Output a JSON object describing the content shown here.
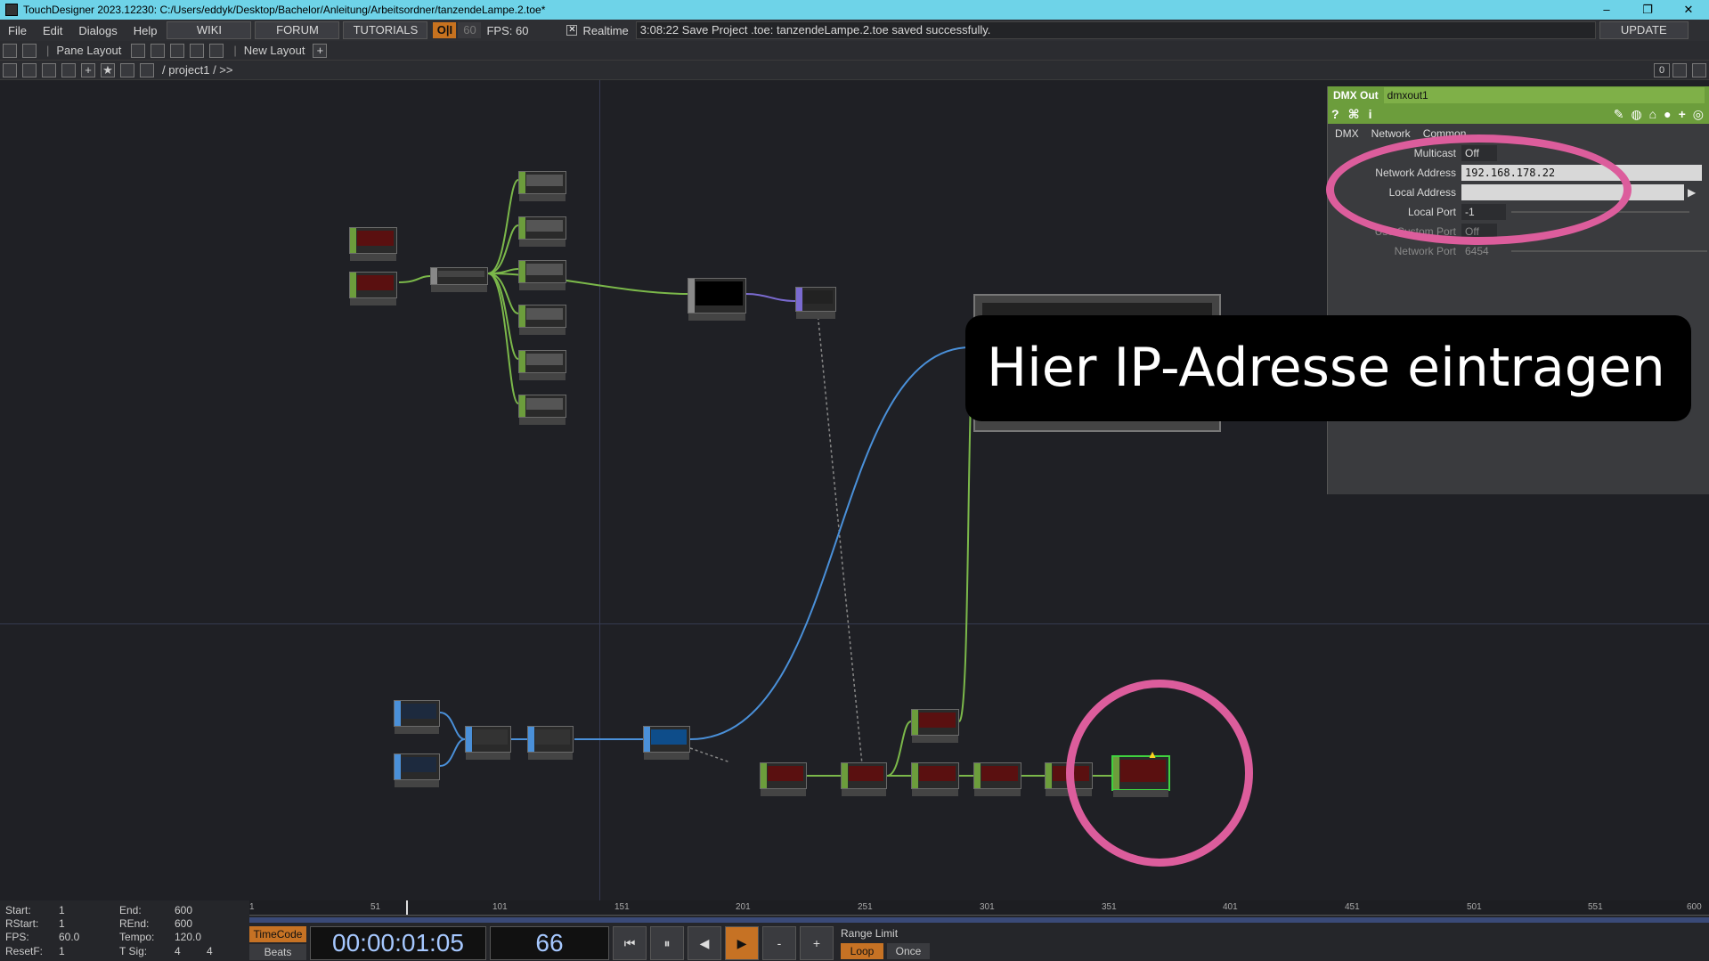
{
  "window": {
    "title": "TouchDesigner 2023.12230: C:/Users/eddyk/Desktop/Bachelor/Anleitung/Arbeitsordner/tanzendeLampe.2.toe*",
    "minimize": "–",
    "maximize": "❐",
    "close": "✕"
  },
  "menu": {
    "items": [
      "File",
      "Edit",
      "Dialogs",
      "Help"
    ],
    "wiki": "WIKI",
    "forum": "FORUM",
    "tutorials": "TUTORIALS",
    "perform": "O|I",
    "sixty": "60",
    "fps": "FPS:   60",
    "realtime": "Realtime",
    "status": "3:08:22 Save Project .toe: tanzendeLampe.2.toe saved successfully.",
    "update": "UPDATE"
  },
  "toolbar": {
    "pane_layout": "Pane Layout",
    "new_layout": "New Layout",
    "path": "/ project1 / >>",
    "zero": "0"
  },
  "param_panel": {
    "op_type": "DMX Out",
    "op_name": "dmxout1",
    "tabs": [
      "DMX",
      "Network",
      "Common"
    ],
    "params": [
      {
        "label": "Multicast",
        "value": "Off"
      },
      {
        "label": "Network Address",
        "value": "192.168.178.22"
      },
      {
        "label": "Local Address",
        "value": ""
      },
      {
        "label": "Local Port",
        "value": "-1"
      },
      {
        "label": "Use Custom Port",
        "value": "Off"
      },
      {
        "label": "Network Port",
        "value": "6454"
      }
    ]
  },
  "callout": "Hier IP-Adresse eintragen",
  "colors": {
    "annotation": "#dc5d9c",
    "chop_green": "#6c9d3c",
    "top_blue": "#4a90d9"
  },
  "timeline": {
    "start_label": "Start:",
    "start": "1",
    "end_label": "End:",
    "end": "600",
    "rstart_label": "RStart:",
    "rstart": "1",
    "rend_label": "REnd:",
    "rend": "600",
    "fps_label": "FPS:",
    "fps": "60.0",
    "tempo_label": "Tempo:",
    "tempo": "120.0",
    "resetf_label": "ResetF:",
    "resetf": "1",
    "tsig_label": "T Sig:",
    "tsig_a": "4",
    "tsig_b": "4",
    "ticks": [
      "1",
      "51",
      "101",
      "151",
      "201",
      "251",
      "301",
      "351",
      "401",
      "451",
      "501",
      "551",
      "600"
    ],
    "timecode_btn": "TimeCode",
    "beats_btn": "Beats",
    "time": "00:00:01:05",
    "frame": "66",
    "range_limit": "Range Limit",
    "loop": "Loop",
    "once": "Once"
  }
}
